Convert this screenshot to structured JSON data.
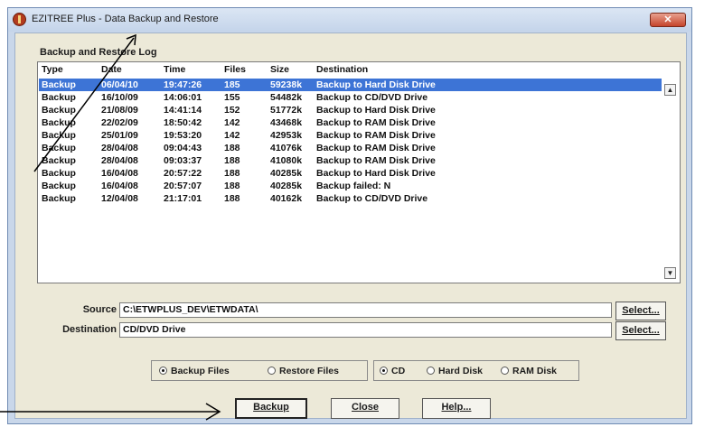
{
  "window": {
    "title": "EZITREE Plus - Data Backup and Restore",
    "close_label": "✕"
  },
  "log": {
    "group_label": "Backup and Restore Log",
    "columns": [
      "Type",
      "Date",
      "Time",
      "Files",
      "Size",
      "Destination"
    ],
    "rows": [
      {
        "type": "Backup",
        "date": "06/04/10",
        "time": "19:47:26",
        "files": "185",
        "size": "59238k",
        "destination": "Backup to Hard Disk Drive",
        "selected": true
      },
      {
        "type": "Backup",
        "date": "16/10/09",
        "time": "14:06:01",
        "files": "155",
        "size": "54482k",
        "destination": "Backup to CD/DVD Drive"
      },
      {
        "type": "Backup",
        "date": "21/08/09",
        "time": "14:41:14",
        "files": "152",
        "size": "51772k",
        "destination": "Backup to Hard Disk Drive"
      },
      {
        "type": "Backup",
        "date": "22/02/09",
        "time": "18:50:42",
        "files": "142",
        "size": "43468k",
        "destination": "Backup to RAM Disk Drive"
      },
      {
        "type": "Backup",
        "date": "25/01/09",
        "time": "19:53:20",
        "files": "142",
        "size": "42953k",
        "destination": "Backup to RAM Disk Drive"
      },
      {
        "type": "Backup",
        "date": "28/04/08",
        "time": "09:04:43",
        "files": "188",
        "size": "41076k",
        "destination": "Backup to RAM Disk Drive"
      },
      {
        "type": "Backup",
        "date": "28/04/08",
        "time": "09:03:37",
        "files": "188",
        "size": "41080k",
        "destination": "Backup to RAM Disk Drive"
      },
      {
        "type": "Backup",
        "date": "16/04/08",
        "time": "20:57:22",
        "files": "188",
        "size": "40285k",
        "destination": "Backup to Hard Disk Drive"
      },
      {
        "type": "Backup",
        "date": "16/04/08",
        "time": "20:57:07",
        "files": "188",
        "size": "40285k",
        "destination": "Backup failed: N"
      },
      {
        "type": "Backup",
        "date": "12/04/08",
        "time": "21:17:01",
        "files": "188",
        "size": "40162k",
        "destination": "Backup to CD/DVD Drive"
      }
    ]
  },
  "source": {
    "label": "Source",
    "value": "C:\\ETWPLUS_DEV\\ETWDATA\\",
    "button": "Select..."
  },
  "destination": {
    "label": "Destination",
    "value": "CD/DVD Drive",
    "button": "Select..."
  },
  "mode": {
    "backup_label": "Backup Files",
    "restore_label": "Restore Files",
    "selected": "backup"
  },
  "media": {
    "cd_label": "CD",
    "hard_disk_label": "Hard Disk",
    "ram_disk_label": "RAM Disk",
    "selected": "cd"
  },
  "buttons": {
    "backup": "Backup",
    "close": "Close",
    "help": "Help..."
  },
  "colors": {
    "selection": "#3d74d6",
    "close_button": "#c5442b"
  }
}
